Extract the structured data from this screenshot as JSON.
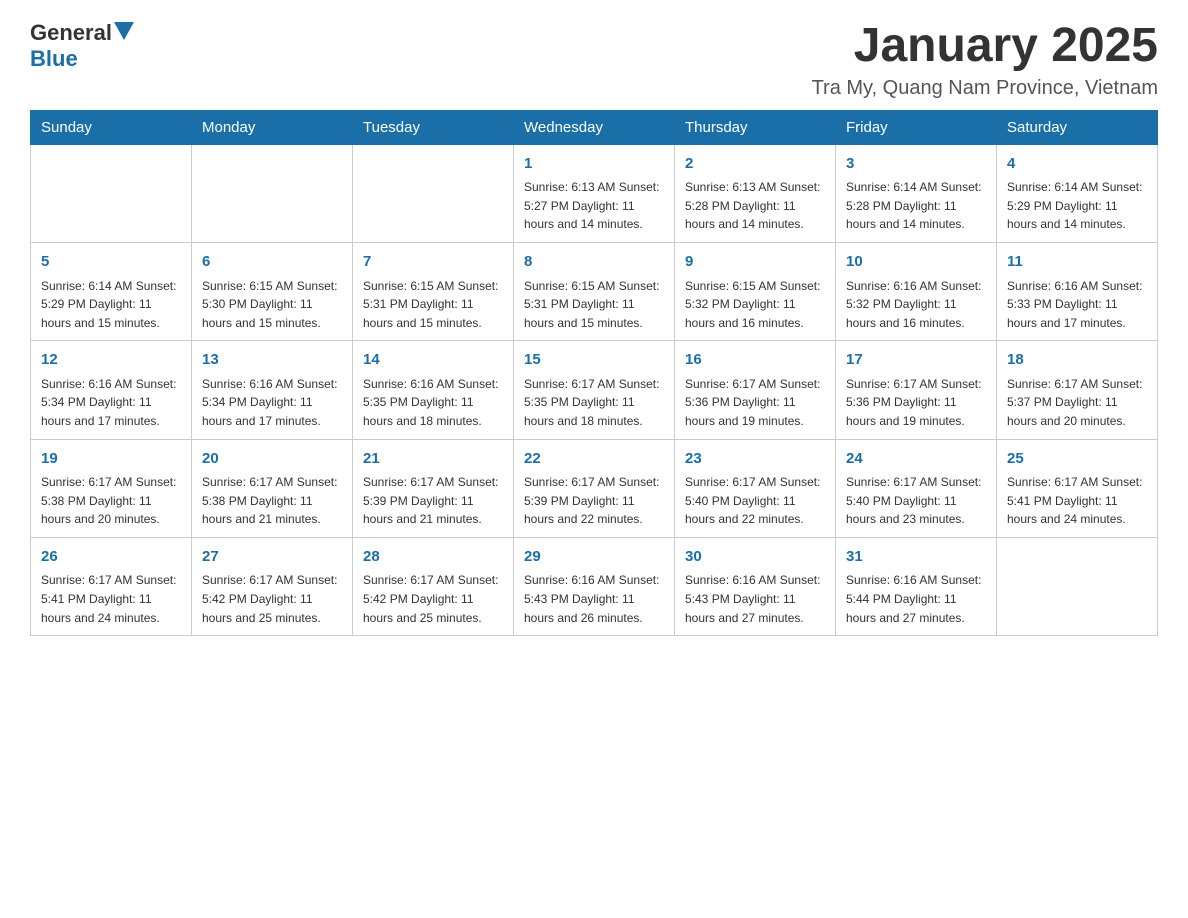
{
  "header": {
    "logo_general": "General",
    "logo_blue": "Blue",
    "month_title": "January 2025",
    "location": "Tra My, Quang Nam Province, Vietnam"
  },
  "days_of_week": [
    "Sunday",
    "Monday",
    "Tuesday",
    "Wednesday",
    "Thursday",
    "Friday",
    "Saturday"
  ],
  "weeks": [
    [
      {
        "day": "",
        "info": ""
      },
      {
        "day": "",
        "info": ""
      },
      {
        "day": "",
        "info": ""
      },
      {
        "day": "1",
        "info": "Sunrise: 6:13 AM\nSunset: 5:27 PM\nDaylight: 11 hours and 14 minutes."
      },
      {
        "day": "2",
        "info": "Sunrise: 6:13 AM\nSunset: 5:28 PM\nDaylight: 11 hours and 14 minutes."
      },
      {
        "day": "3",
        "info": "Sunrise: 6:14 AM\nSunset: 5:28 PM\nDaylight: 11 hours and 14 minutes."
      },
      {
        "day": "4",
        "info": "Sunrise: 6:14 AM\nSunset: 5:29 PM\nDaylight: 11 hours and 14 minutes."
      }
    ],
    [
      {
        "day": "5",
        "info": "Sunrise: 6:14 AM\nSunset: 5:29 PM\nDaylight: 11 hours and 15 minutes."
      },
      {
        "day": "6",
        "info": "Sunrise: 6:15 AM\nSunset: 5:30 PM\nDaylight: 11 hours and 15 minutes."
      },
      {
        "day": "7",
        "info": "Sunrise: 6:15 AM\nSunset: 5:31 PM\nDaylight: 11 hours and 15 minutes."
      },
      {
        "day": "8",
        "info": "Sunrise: 6:15 AM\nSunset: 5:31 PM\nDaylight: 11 hours and 15 minutes."
      },
      {
        "day": "9",
        "info": "Sunrise: 6:15 AM\nSunset: 5:32 PM\nDaylight: 11 hours and 16 minutes."
      },
      {
        "day": "10",
        "info": "Sunrise: 6:16 AM\nSunset: 5:32 PM\nDaylight: 11 hours and 16 minutes."
      },
      {
        "day": "11",
        "info": "Sunrise: 6:16 AM\nSunset: 5:33 PM\nDaylight: 11 hours and 17 minutes."
      }
    ],
    [
      {
        "day": "12",
        "info": "Sunrise: 6:16 AM\nSunset: 5:34 PM\nDaylight: 11 hours and 17 minutes."
      },
      {
        "day": "13",
        "info": "Sunrise: 6:16 AM\nSunset: 5:34 PM\nDaylight: 11 hours and 17 minutes."
      },
      {
        "day": "14",
        "info": "Sunrise: 6:16 AM\nSunset: 5:35 PM\nDaylight: 11 hours and 18 minutes."
      },
      {
        "day": "15",
        "info": "Sunrise: 6:17 AM\nSunset: 5:35 PM\nDaylight: 11 hours and 18 minutes."
      },
      {
        "day": "16",
        "info": "Sunrise: 6:17 AM\nSunset: 5:36 PM\nDaylight: 11 hours and 19 minutes."
      },
      {
        "day": "17",
        "info": "Sunrise: 6:17 AM\nSunset: 5:36 PM\nDaylight: 11 hours and 19 minutes."
      },
      {
        "day": "18",
        "info": "Sunrise: 6:17 AM\nSunset: 5:37 PM\nDaylight: 11 hours and 20 minutes."
      }
    ],
    [
      {
        "day": "19",
        "info": "Sunrise: 6:17 AM\nSunset: 5:38 PM\nDaylight: 11 hours and 20 minutes."
      },
      {
        "day": "20",
        "info": "Sunrise: 6:17 AM\nSunset: 5:38 PM\nDaylight: 11 hours and 21 minutes."
      },
      {
        "day": "21",
        "info": "Sunrise: 6:17 AM\nSunset: 5:39 PM\nDaylight: 11 hours and 21 minutes."
      },
      {
        "day": "22",
        "info": "Sunrise: 6:17 AM\nSunset: 5:39 PM\nDaylight: 11 hours and 22 minutes."
      },
      {
        "day": "23",
        "info": "Sunrise: 6:17 AM\nSunset: 5:40 PM\nDaylight: 11 hours and 22 minutes."
      },
      {
        "day": "24",
        "info": "Sunrise: 6:17 AM\nSunset: 5:40 PM\nDaylight: 11 hours and 23 minutes."
      },
      {
        "day": "25",
        "info": "Sunrise: 6:17 AM\nSunset: 5:41 PM\nDaylight: 11 hours and 24 minutes."
      }
    ],
    [
      {
        "day": "26",
        "info": "Sunrise: 6:17 AM\nSunset: 5:41 PM\nDaylight: 11 hours and 24 minutes."
      },
      {
        "day": "27",
        "info": "Sunrise: 6:17 AM\nSunset: 5:42 PM\nDaylight: 11 hours and 25 minutes."
      },
      {
        "day": "28",
        "info": "Sunrise: 6:17 AM\nSunset: 5:42 PM\nDaylight: 11 hours and 25 minutes."
      },
      {
        "day": "29",
        "info": "Sunrise: 6:16 AM\nSunset: 5:43 PM\nDaylight: 11 hours and 26 minutes."
      },
      {
        "day": "30",
        "info": "Sunrise: 6:16 AM\nSunset: 5:43 PM\nDaylight: 11 hours and 27 minutes."
      },
      {
        "day": "31",
        "info": "Sunrise: 6:16 AM\nSunset: 5:44 PM\nDaylight: 11 hours and 27 minutes."
      },
      {
        "day": "",
        "info": ""
      }
    ]
  ]
}
